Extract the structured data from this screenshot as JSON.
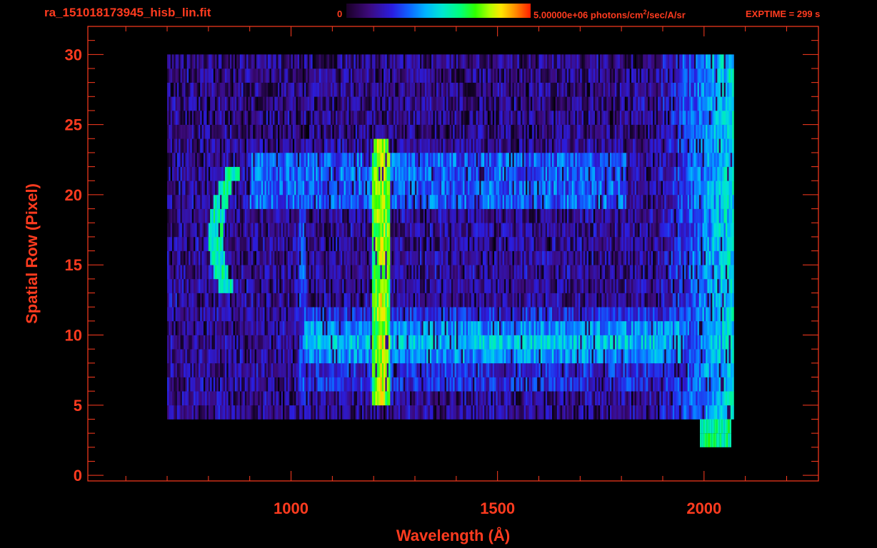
{
  "chart_data": {
    "type": "heatmap",
    "title": "ra_151018173945_hisb_lin.fit",
    "colorbar": {
      "min_label": "0",
      "max_label": "5.00000e+06 photons/cm",
      "max_unit_sup": "2",
      "max_unit_tail": "/sec/A/sr",
      "min": 0,
      "max": 5000000
    },
    "annotation": "EXPTIME = 299 s",
    "xlabel": "Wavelength (Å)",
    "ylabel": "Spatial Row (Pixel)",
    "xlim": [
      508,
      2277
    ],
    "ylim": [
      -0.4,
      32
    ],
    "xticks": [
      1000,
      1500,
      2000
    ],
    "yticks": [
      0,
      5,
      10,
      15,
      20,
      25,
      30
    ],
    "x_minor_step": 100,
    "y_minor_step": 1,
    "grid": false,
    "data_range": {
      "wavelength": [
        700,
        2070
      ],
      "rows": [
        4,
        30
      ]
    },
    "features": [
      {
        "name": "Lyman-alpha 1216",
        "wavelength": 1216,
        "rows": [
          5,
          24
        ],
        "level": "green-yellow"
      },
      {
        "name": "continuum band",
        "wavelength": [
          1030,
          1950
        ],
        "rows": [
          8,
          11
        ],
        "level": "cyan"
      },
      {
        "name": "upper band",
        "wavelength": [
          900,
          1810
        ],
        "rows": [
          19,
          23
        ],
        "level": "blue-cyan"
      },
      {
        "name": "curved feature",
        "wavelength": [
          815,
          900
        ],
        "rows": [
          13,
          22
        ],
        "level": "green"
      },
      {
        "name": "line 1026",
        "wavelength": 1026,
        "rows": [
          5,
          23
        ],
        "level": "blue"
      },
      {
        "name": "red edge",
        "wavelength": [
          1900,
          2065
        ],
        "rows": [
          2,
          30
        ],
        "level": "green"
      }
    ],
    "colors": {
      "axis": "#ff3b1f",
      "background": "#000000"
    }
  }
}
